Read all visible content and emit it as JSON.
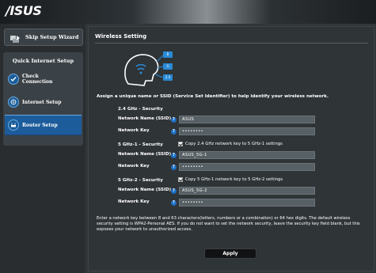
{
  "header": {
    "logo_text": "/ISUS"
  },
  "sidebar": {
    "skip_label": "Skip Setup Wizard",
    "qis_title": "Quick Internet Setup",
    "items": [
      {
        "label_line1": "Check",
        "label_line2": "Connection",
        "icon": "check-icon"
      },
      {
        "label_line1": "Internet Setup",
        "label_line2": "",
        "icon": "globe-icon"
      },
      {
        "label_line1": "Router Setup",
        "label_line2": "",
        "icon": "router-icon",
        "active": true
      }
    ]
  },
  "main": {
    "title": "Wireless Setting",
    "illustration": {
      "tags": [
        "B",
        "G",
        "2.4"
      ]
    },
    "instruction": "Assign a unique name or SSID (Service Set Identifier) to help identify your wireless network.",
    "bands": [
      {
        "section": "2.4 GHz - Security",
        "ssid_label": "Network Name (SSID)",
        "ssid_value": "ASUS",
        "key_label": "Network Key",
        "key_value": "••••••••"
      },
      {
        "section": "5 GHz-1 - Security",
        "copy_label": "Copy 2.4 GHz network key to 5 GHz-1 settings",
        "ssid_label": "Network Name (SSID)",
        "ssid_value": "ASUS_5G-1",
        "key_label": "Network Key",
        "key_value": "••••••••"
      },
      {
        "section": "5 GHz-2 - Security",
        "copy_label": "Copy 5 GHz-1 network key to 5 GHz-2 settings",
        "ssid_label": "Network Name (SSID)",
        "ssid_value": "ASUS_5G-2",
        "key_label": "Network Key",
        "key_value": "••••••••"
      }
    ],
    "help_glyph": "?",
    "note": "Enter a network key between 8 and 63 characters(letters, numbers or a combination) or 64 hex digits. The default wireless security setting is WPA2-Personal AES. If you do not want to set the network security, leave the security key field blank, but this exposes your network to unauthorized access.",
    "apply_label": "Apply"
  },
  "colors": {
    "accent_blue": "#1d5c9b",
    "help_blue": "#1e6fc4",
    "illus_blue": "#2a8ad6"
  }
}
